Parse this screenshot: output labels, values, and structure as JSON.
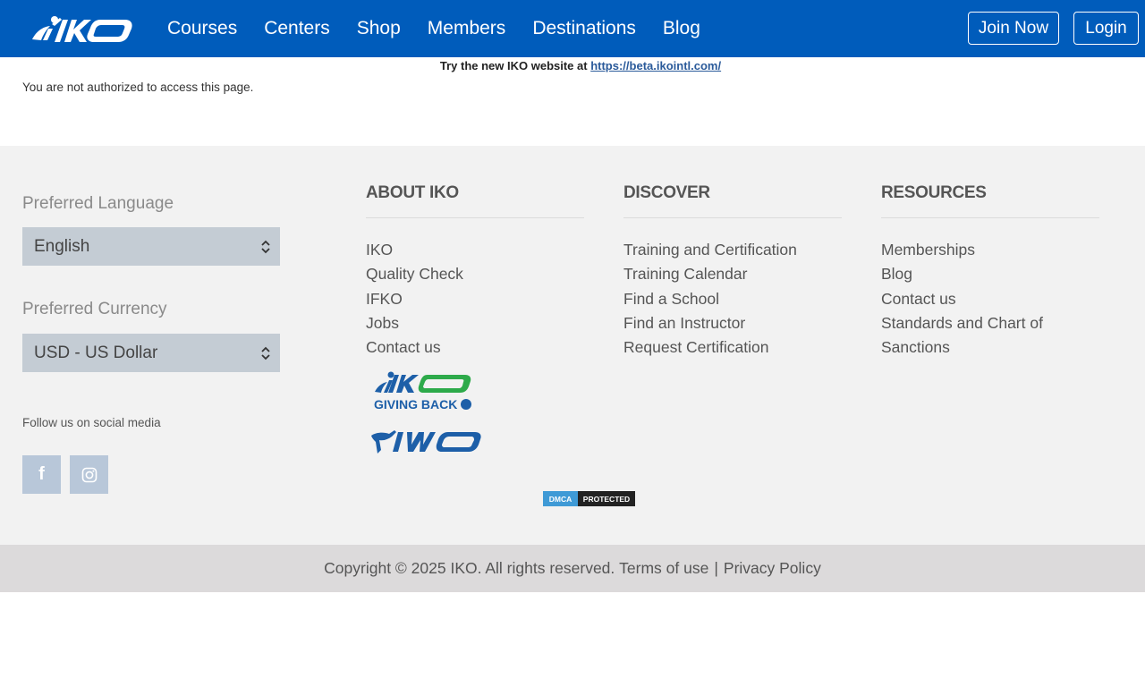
{
  "header": {
    "logo_icon": "iko-logo-icon",
    "nav": [
      "Courses",
      "Centers",
      "Shop",
      "Members",
      "Destinations",
      "Blog"
    ],
    "join_label": "Join Now",
    "login_label": "Login",
    "brand_color": "#005cbb"
  },
  "notice": {
    "text": "Try the new IKO website at ",
    "link": "https://beta.ikointl.com/"
  },
  "main": {
    "message": "You are not authorized to access this page."
  },
  "footer": {
    "language_label": "Preferred Language",
    "language_value": "English",
    "currency_label": "Preferred Currency",
    "currency_value": "USD - US Dollar",
    "follow_label": "Follow us on social media",
    "social": [
      {
        "icon": "facebook-icon",
        "glyph": "f"
      },
      {
        "icon": "instagram-icon"
      }
    ],
    "columns": [
      {
        "title": "ABOUT IKO",
        "items": [
          "IKO",
          "Quality Check",
          "IFKO",
          "Jobs",
          "Contact us"
        ]
      },
      {
        "title": "DISCOVER",
        "items": [
          "Training and Certification",
          "Training Calendar",
          "Find a School",
          "Find an Instructor",
          "Request Certification"
        ]
      },
      {
        "title": "RESOURCES",
        "items": [
          "Memberships",
          "Blog",
          "Contact us",
          "Standards and Chart of Sanctions"
        ]
      }
    ],
    "giving_back_logo": {
      "brand": "iKO",
      "tagline": "GIVING BACK"
    },
    "iwo_logo": {
      "brand": "iwo"
    },
    "dmca": {
      "left": "DMCA",
      "right": "PROTECTED"
    }
  },
  "copyright": {
    "text": "Copyright © 2025 IKO. All rights reserved.",
    "terms": "Terms of use",
    "separator": "|",
    "privacy": "Privacy Policy"
  }
}
